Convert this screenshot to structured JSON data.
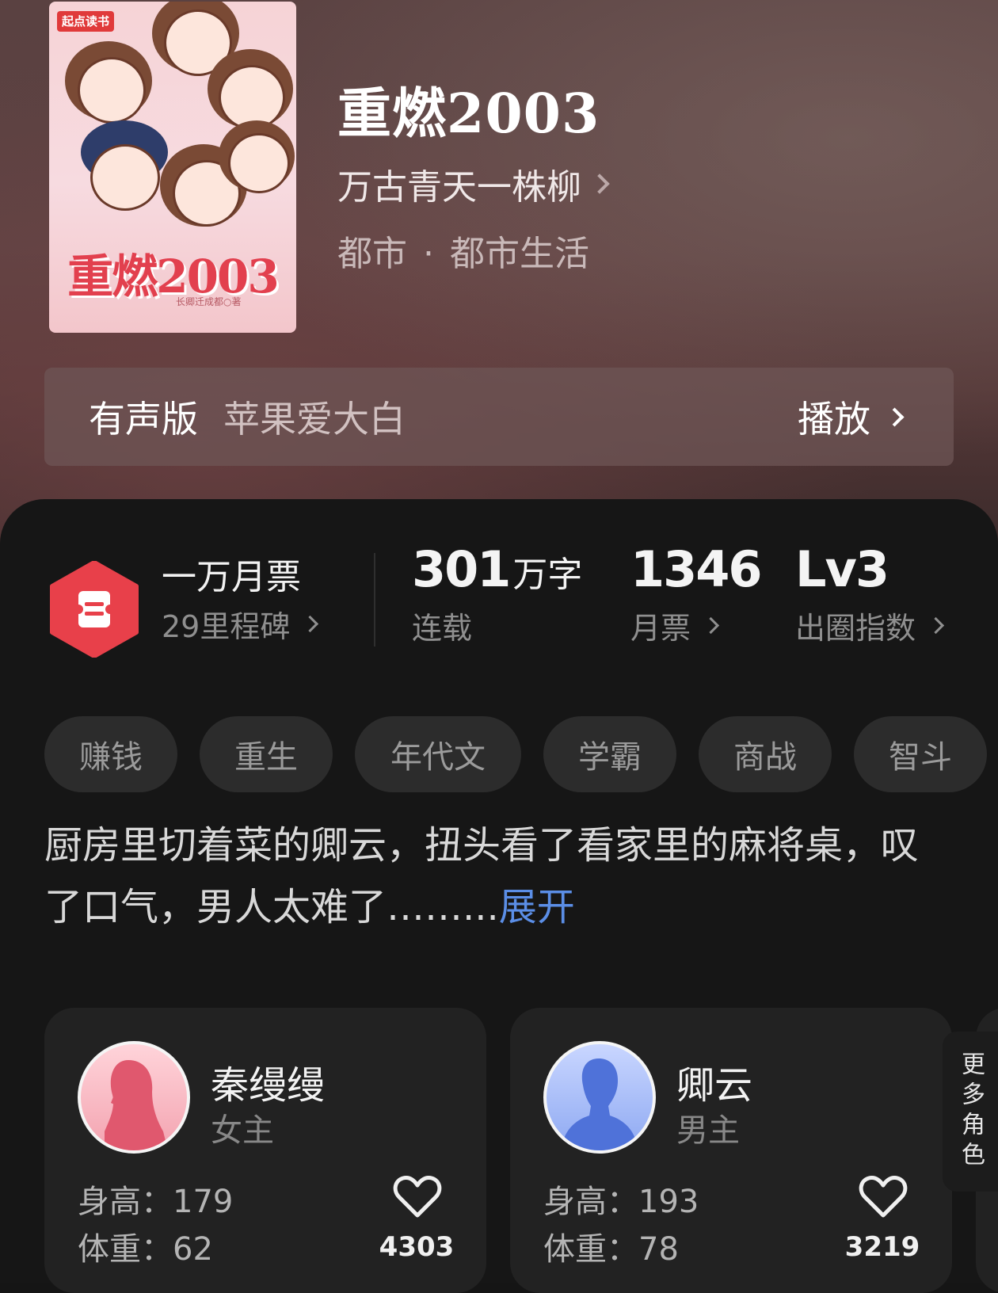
{
  "book": {
    "cover_badge": "起点读书",
    "cover_title": "重燃2003",
    "cover_author": "长卿迁成都○著",
    "title": "重燃2003",
    "author": "万古青天一株柳",
    "genre": "都市",
    "subgenre": "都市生活",
    "genre_sep": "·"
  },
  "audio": {
    "label": "有声版",
    "narrator": "苹果爱大白",
    "play_label": "播放"
  },
  "stats": {
    "tickets_title": "一万月票",
    "milestone": "29里程碑",
    "word_count": "301",
    "word_unit": "万字",
    "status": "连载",
    "monthly_votes": "1346",
    "monthly_votes_label": "月票",
    "level": "Lv3",
    "level_label": "出圈指数"
  },
  "tags": [
    "赚钱",
    "重生",
    "年代文",
    "学霸",
    "商战",
    "智斗"
  ],
  "synopsis": {
    "text": "厨房里切着菜的卿云，扭头看了看家里的麻将桌，叹了口气，男人太难了……...",
    "expand": "展开"
  },
  "characters": [
    {
      "name": "秦缦缦",
      "role": "女主",
      "height": "身高：179",
      "weight": "体重：62",
      "likes": "4303"
    },
    {
      "name": "卿云",
      "role": "男主",
      "height": "身高：193",
      "weight": "体重：78",
      "likes": "3219"
    }
  ],
  "more_roles": "更多角色",
  "colors": {
    "accent_blue": "#5b8ee6",
    "ticket_red": "#e8404a",
    "female_avatar": "#f08a9a",
    "male_avatar": "#6f8ef0"
  }
}
